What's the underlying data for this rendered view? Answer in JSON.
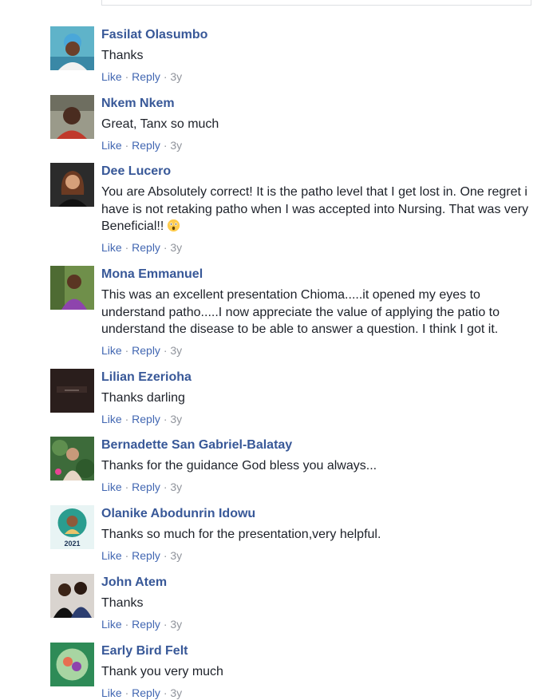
{
  "comments": [
    {
      "author": "Fasilat Olasumbo",
      "text": "Thanks",
      "like": "Like",
      "reply": "Reply",
      "time": "3y"
    },
    {
      "author": "Nkem Nkem",
      "text": "Great, Tanx so much",
      "like": "Like",
      "reply": "Reply",
      "time": "3y"
    },
    {
      "author": "Dee Lucero",
      "text": "You are Absolutely correct! It is the patho level that I get lost in. One regret i have is not retaking patho when I was accepted into Nursing. That was very Beneficial!!",
      "emoji": "astonished-face",
      "like": "Like",
      "reply": "Reply",
      "time": "3y"
    },
    {
      "author": "Mona Emmanuel",
      "text": "This was an excellent presentation Chioma.....it opened my eyes to understand patho.....I now appreciate the value of applying the patio to understand the disease to be able to answer a question. I think I got it.",
      "like": "Like",
      "reply": "Reply",
      "time": "3y"
    },
    {
      "author": "Lilian Ezerioha",
      "text": "Thanks darling",
      "like": "Like",
      "reply": "Reply",
      "time": "3y"
    },
    {
      "author": "Bernadette San Gabriel-Balatay",
      "text": "Thanks for the guidance God bless you always...",
      "like": "Like",
      "reply": "Reply",
      "time": "3y"
    },
    {
      "author": "Olanike Abodunrin Idowu",
      "text": "Thanks so much for the presentation,very helpful.",
      "avatar_text": "2021",
      "like": "Like",
      "reply": "Reply",
      "time": "3y"
    },
    {
      "author": "John Atem",
      "text": "Thanks",
      "like": "Like",
      "reply": "Reply",
      "time": "3y"
    },
    {
      "author": "Early Bird Felt",
      "text": "Thank you very much",
      "like": "Like",
      "reply": "Reply",
      "time": "3y"
    }
  ],
  "separator": "·",
  "colors": {
    "author": "#385898",
    "link": "#4267b2",
    "meta": "#90949c",
    "text": "#1d2129"
  }
}
